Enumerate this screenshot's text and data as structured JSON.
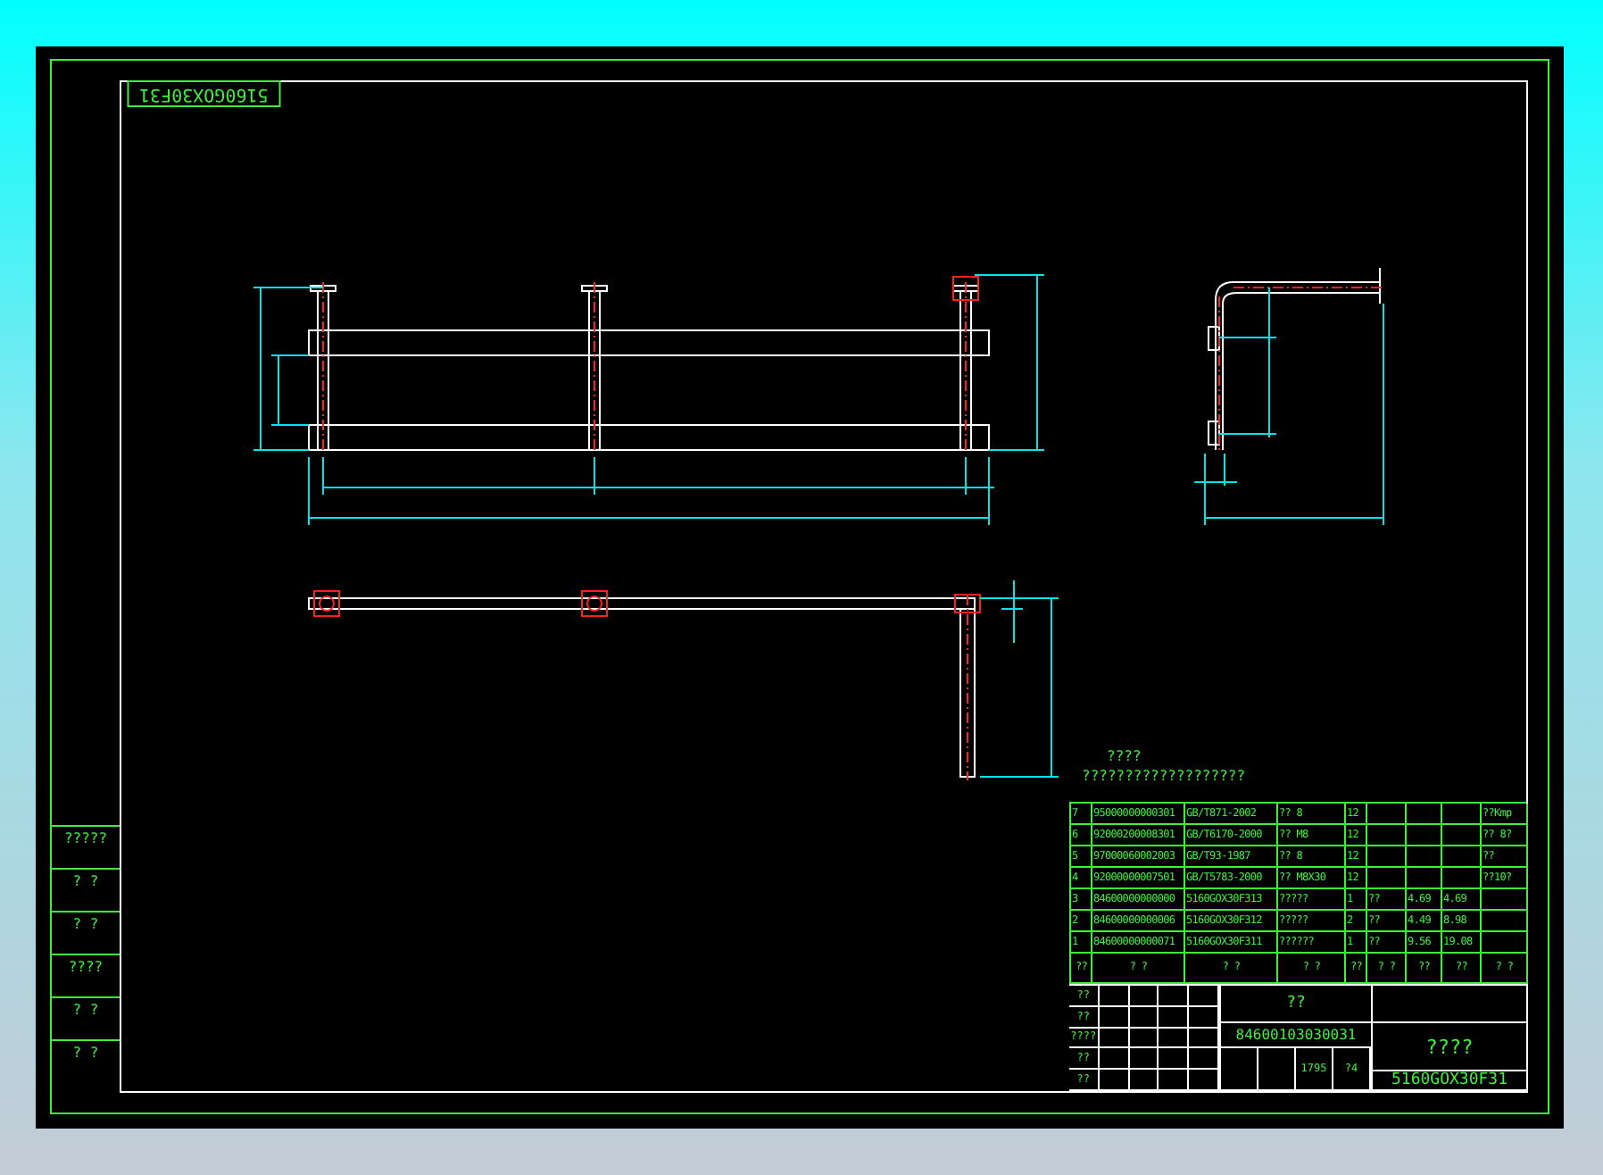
{
  "drawing_label": "5160GOX30F31",
  "left_strip": [
    "?????",
    "? ?",
    "? ?",
    "????",
    "? ?",
    "? ?"
  ],
  "notes": {
    "title": "????",
    "text": "???????????????????"
  },
  "parts_list": {
    "rows": [
      [
        "7",
        "95000000000301",
        "GB/T871-2002",
        "?? 8",
        "12",
        "",
        "",
        "",
        "??Kmp"
      ],
      [
        "6",
        "92000200008301",
        "GB/T6170-2000",
        "?? M8",
        "12",
        "",
        "",
        "",
        "?? 8?"
      ],
      [
        "5",
        "97000060002003",
        "GB/T93-1987",
        "?? 8",
        "12",
        "",
        "",
        "",
        "??"
      ],
      [
        "4",
        "92000000007501",
        "GB/T5783-2000",
        "?? M8X30",
        "12",
        "",
        "",
        "",
        "??10?"
      ],
      [
        "3",
        "84600000000000",
        "5160GOX30F313",
        "?????",
        "1",
        "??",
        "4.69",
        "4.69",
        ""
      ],
      [
        "2",
        "84600000000006",
        "5160GOX30F312",
        "?????",
        "2",
        "??",
        "4.49",
        "8.98",
        ""
      ],
      [
        "1",
        "84600000000071",
        "5160GOX30F311",
        "??????",
        "1",
        "??",
        "9.56",
        "19.08",
        ""
      ]
    ],
    "header": [
      "??",
      "?  ?",
      "?  ?",
      "?  ?",
      "??",
      "?  ?",
      "??",
      "??",
      "? ?"
    ]
  },
  "title_block": {
    "name": "??",
    "code": "84600103030031",
    "company": "????",
    "drawing_number": "5160GOX30F31",
    "scale": "1795",
    "sheet": "?4",
    "signatures": [
      "??",
      "??",
      "????",
      "??",
      "??"
    ]
  }
}
